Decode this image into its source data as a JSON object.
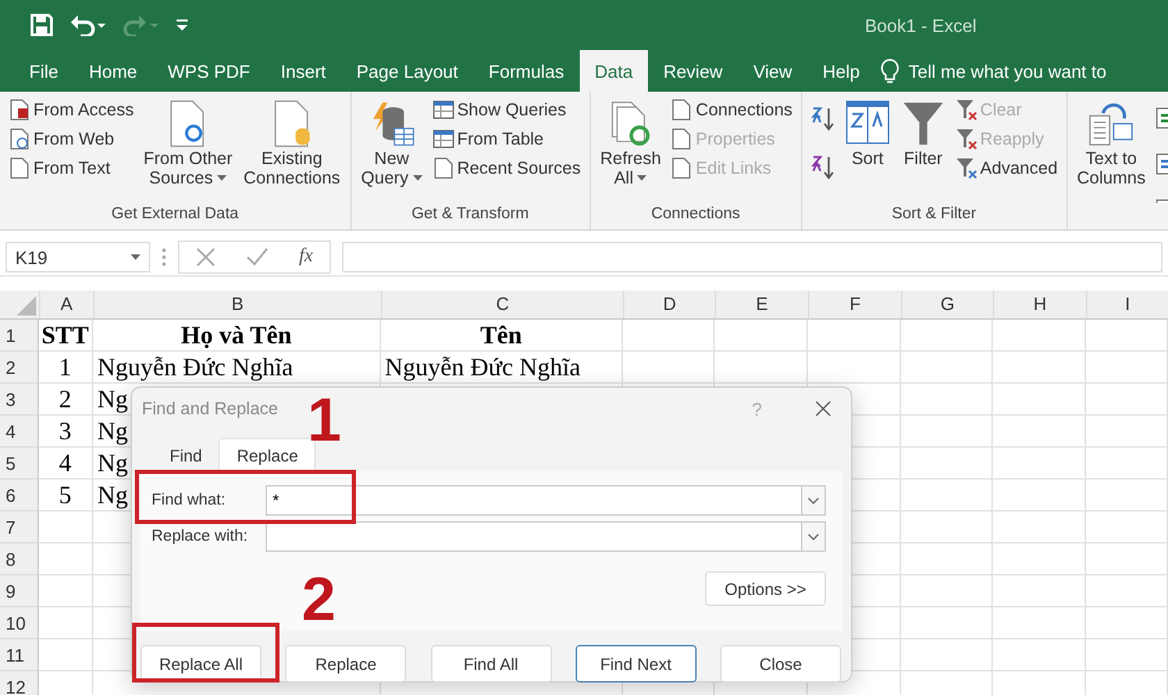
{
  "window": {
    "title": "Book1 - Excel"
  },
  "quick_access": [
    {
      "kind": "save",
      "disabled": false
    },
    {
      "kind": "undo",
      "disabled": false
    },
    {
      "kind": "redo",
      "disabled": true
    },
    {
      "kind": "customize",
      "disabled": false
    }
  ],
  "tabs": [
    {
      "label": "File",
      "selected": false
    },
    {
      "label": "Home",
      "selected": false
    },
    {
      "label": "WPS PDF",
      "selected": false
    },
    {
      "label": "Insert",
      "selected": false
    },
    {
      "label": "Page Layout",
      "selected": false
    },
    {
      "label": "Formulas",
      "selected": false
    },
    {
      "label": "Data",
      "selected": true
    },
    {
      "label": "Review",
      "selected": false
    },
    {
      "label": "View",
      "selected": false
    },
    {
      "label": "Help",
      "selected": false
    }
  ],
  "tell_me": {
    "placeholder": "Tell me what you want to"
  },
  "ribbon": {
    "groups": [
      {
        "label": "Get External Data",
        "columns": [
          {
            "kind": "stack",
            "items": [
              {
                "label": "From Access",
                "disabled": false
              },
              {
                "label": "From Web",
                "disabled": false
              },
              {
                "label": "From Text",
                "disabled": false
              }
            ]
          },
          {
            "kind": "large",
            "lines": [
              "From Other",
              "Sources"
            ],
            "dropdown": true,
            "disabled": false
          },
          {
            "kind": "large",
            "lines": [
              "Existing",
              "Connections"
            ],
            "dropdown": false,
            "disabled": false
          }
        ]
      },
      {
        "label": "Get & Transform",
        "columns": [
          {
            "kind": "large",
            "lines": [
              "New",
              "Query"
            ],
            "dropdown": true,
            "disabled": false
          },
          {
            "kind": "stack",
            "items": [
              {
                "label": "Show Queries",
                "disabled": false
              },
              {
                "label": "From Table",
                "disabled": false
              },
              {
                "label": "Recent Sources",
                "disabled": false
              }
            ]
          }
        ]
      },
      {
        "label": "Connections",
        "columns": [
          {
            "kind": "large",
            "lines": [
              "Refresh",
              "All"
            ],
            "dropdown": true,
            "disabled": false
          },
          {
            "kind": "stack",
            "items": [
              {
                "label": "Connections",
                "disabled": false
              },
              {
                "label": "Properties",
                "disabled": true
              },
              {
                "label": "Edit Links",
                "disabled": true
              }
            ]
          }
        ]
      },
      {
        "label": "Sort & Filter",
        "columns": [
          {
            "kind": "icons",
            "items": [
              {
                "disabled": false
              },
              {
                "disabled": false
              }
            ]
          },
          {
            "kind": "large",
            "lines": [
              "Sort"
            ],
            "dropdown": false,
            "disabled": false
          },
          {
            "kind": "large",
            "lines": [
              "Filter"
            ],
            "dropdown": false,
            "disabled": false
          },
          {
            "kind": "stack",
            "items": [
              {
                "label": "Clear",
                "disabled": true
              },
              {
                "label": "Reapply",
                "disabled": true
              },
              {
                "label": "Advanced",
                "disabled": false
              }
            ]
          }
        ]
      },
      {
        "columns": [
          {
            "kind": "large",
            "lines": [
              "Text to",
              "Columns"
            ],
            "dropdown": false,
            "disabled": false
          },
          {
            "kind": "icons",
            "items": [
              {
                "disabled": false
              },
              {
                "disabled": false
              },
              {
                "disabled": false
              }
            ]
          }
        ]
      }
    ]
  },
  "formula_bar": {
    "name_box": "K19",
    "fx": "fx"
  },
  "sheet": {
    "columns": [
      "A",
      "B",
      "C",
      "D",
      "E",
      "F",
      "G",
      "H",
      "I"
    ],
    "rows": [
      {
        "number": "1",
        "cells": [
          "STT",
          "Họ và Tên",
          "Tên"
        ]
      },
      {
        "number": "2",
        "cells": [
          "1",
          "Nguyễn Đức Nghĩa",
          "Nguyễn Đức Nghĩa"
        ]
      },
      {
        "number": "3",
        "cells": [
          "2",
          "Ng",
          ""
        ]
      },
      {
        "number": "4",
        "cells": [
          "3",
          "Ng",
          ""
        ]
      },
      {
        "number": "5",
        "cells": [
          "4",
          "Ng",
          ""
        ]
      },
      {
        "number": "6",
        "cells": [
          "5",
          "Ng",
          ""
        ]
      },
      {
        "number": "7",
        "cells": []
      },
      {
        "number": "8",
        "cells": []
      },
      {
        "number": "9",
        "cells": []
      },
      {
        "number": "10",
        "cells": []
      },
      {
        "number": "11",
        "cells": []
      },
      {
        "number": "12",
        "cells": []
      }
    ]
  },
  "dialog": {
    "title": "Find and Replace",
    "help": "?",
    "tabs": [
      {
        "label": "Find",
        "selected": false
      },
      {
        "label": "Replace",
        "selected": true
      }
    ],
    "fields": [
      {
        "label": "Find what:",
        "value": "*"
      },
      {
        "label": "Replace with:"
      }
    ],
    "options_button": "Options >>",
    "buttons": [
      {
        "label": "Replace All",
        "default": false
      },
      {
        "label": "Replace",
        "default": false
      },
      {
        "label": "Find All",
        "default": false
      },
      {
        "label": "Find Next",
        "default": true
      },
      {
        "label": "Close",
        "default": false
      }
    ]
  },
  "annotations": [
    {
      "label": "1"
    },
    {
      "label": "2"
    }
  ]
}
